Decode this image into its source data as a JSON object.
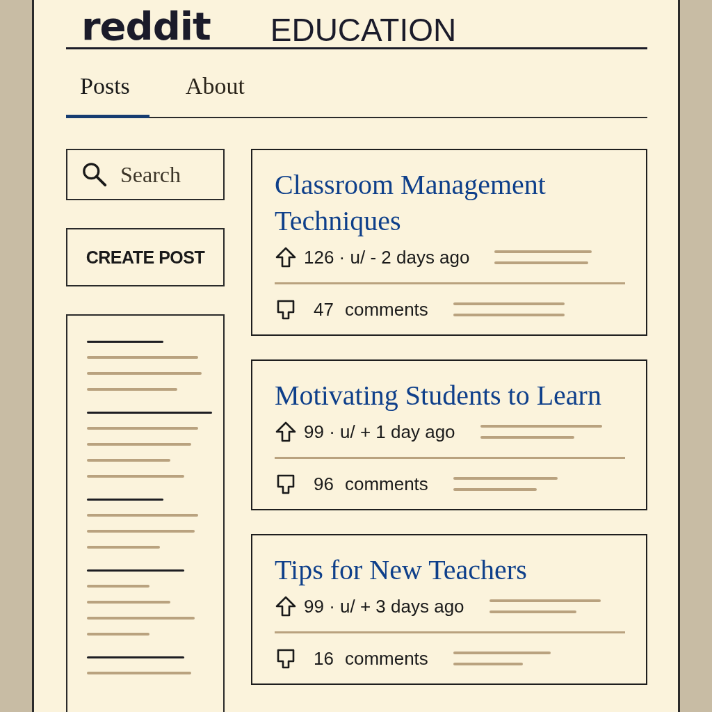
{
  "header": {
    "logo": "reddit",
    "community": "EDUCATION"
  },
  "tabs": [
    {
      "label": "Posts",
      "selected": true
    },
    {
      "label": "About",
      "selected": false
    }
  ],
  "search": {
    "placeholder": "Search"
  },
  "create_button": "CREATE POST",
  "posts": [
    {
      "title": "Classroom Management Techniques",
      "meta": "126 · u/ -  2 days ago",
      "comment_count": "47",
      "comment_label": "comments"
    },
    {
      "title": "Motivating Students to Learn",
      "meta": "99 · u/ + 1 day ago",
      "comment_count": "96",
      "comment_label": "comments"
    },
    {
      "title": "Tips for New Teachers",
      "meta": "99 · u/ + 3 days ago",
      "comment_count": "16",
      "comment_label": "comments"
    }
  ]
}
